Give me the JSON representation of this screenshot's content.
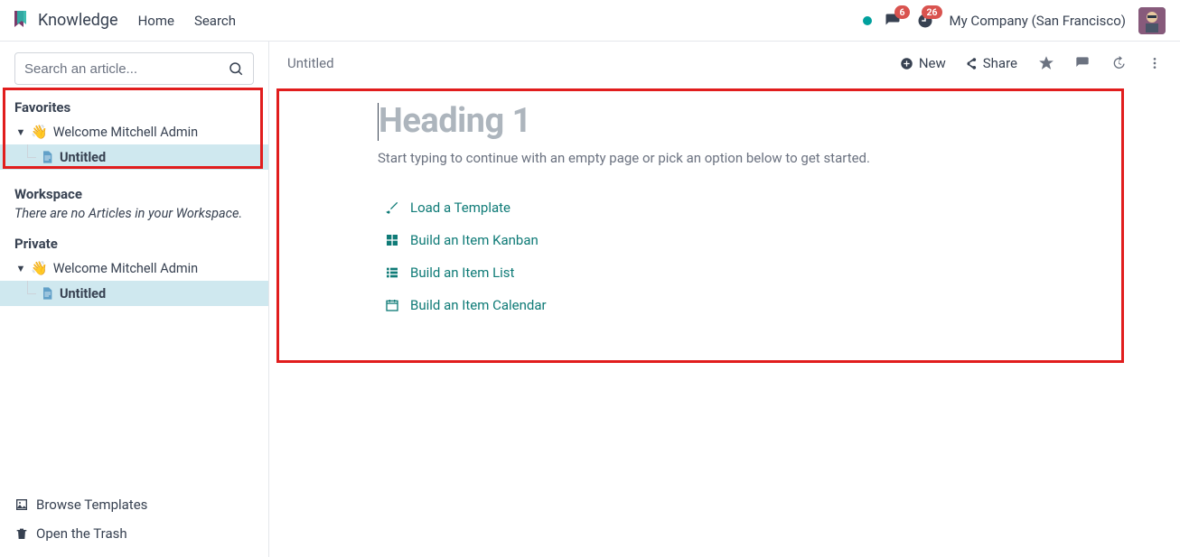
{
  "nav": {
    "app_name": "Knowledge",
    "links": [
      "Home",
      "Search"
    ],
    "company": "My Company (San Francisco)",
    "messages_badge": "6",
    "activities_badge": "26"
  },
  "sidebar": {
    "search_placeholder": "Search an article...",
    "favorites": {
      "title": "Favorites",
      "root": {
        "emoji": "👋",
        "label": "Welcome Mitchell Admin"
      },
      "child": {
        "label": "Untitled"
      }
    },
    "workspace": {
      "title": "Workspace",
      "empty_text": "There are no Articles in your Workspace."
    },
    "private": {
      "title": "Private",
      "root": {
        "emoji": "👋",
        "label": "Welcome Mitchell Admin"
      },
      "child": {
        "label": "Untitled"
      }
    },
    "bottom": {
      "browse_templates": "Browse Templates",
      "open_trash": "Open the Trash"
    }
  },
  "content": {
    "breadcrumb": "Untitled",
    "header": {
      "new_label": "New",
      "share_label": "Share"
    },
    "editor": {
      "heading_placeholder": "Heading 1",
      "sub_placeholder": "Start typing to continue with an empty page or pick an option below to get started.",
      "options": {
        "load_template": "Load a Template",
        "build_kanban": "Build an Item Kanban",
        "build_list": "Build an Item List",
        "build_calendar": "Build an Item Calendar"
      }
    }
  }
}
